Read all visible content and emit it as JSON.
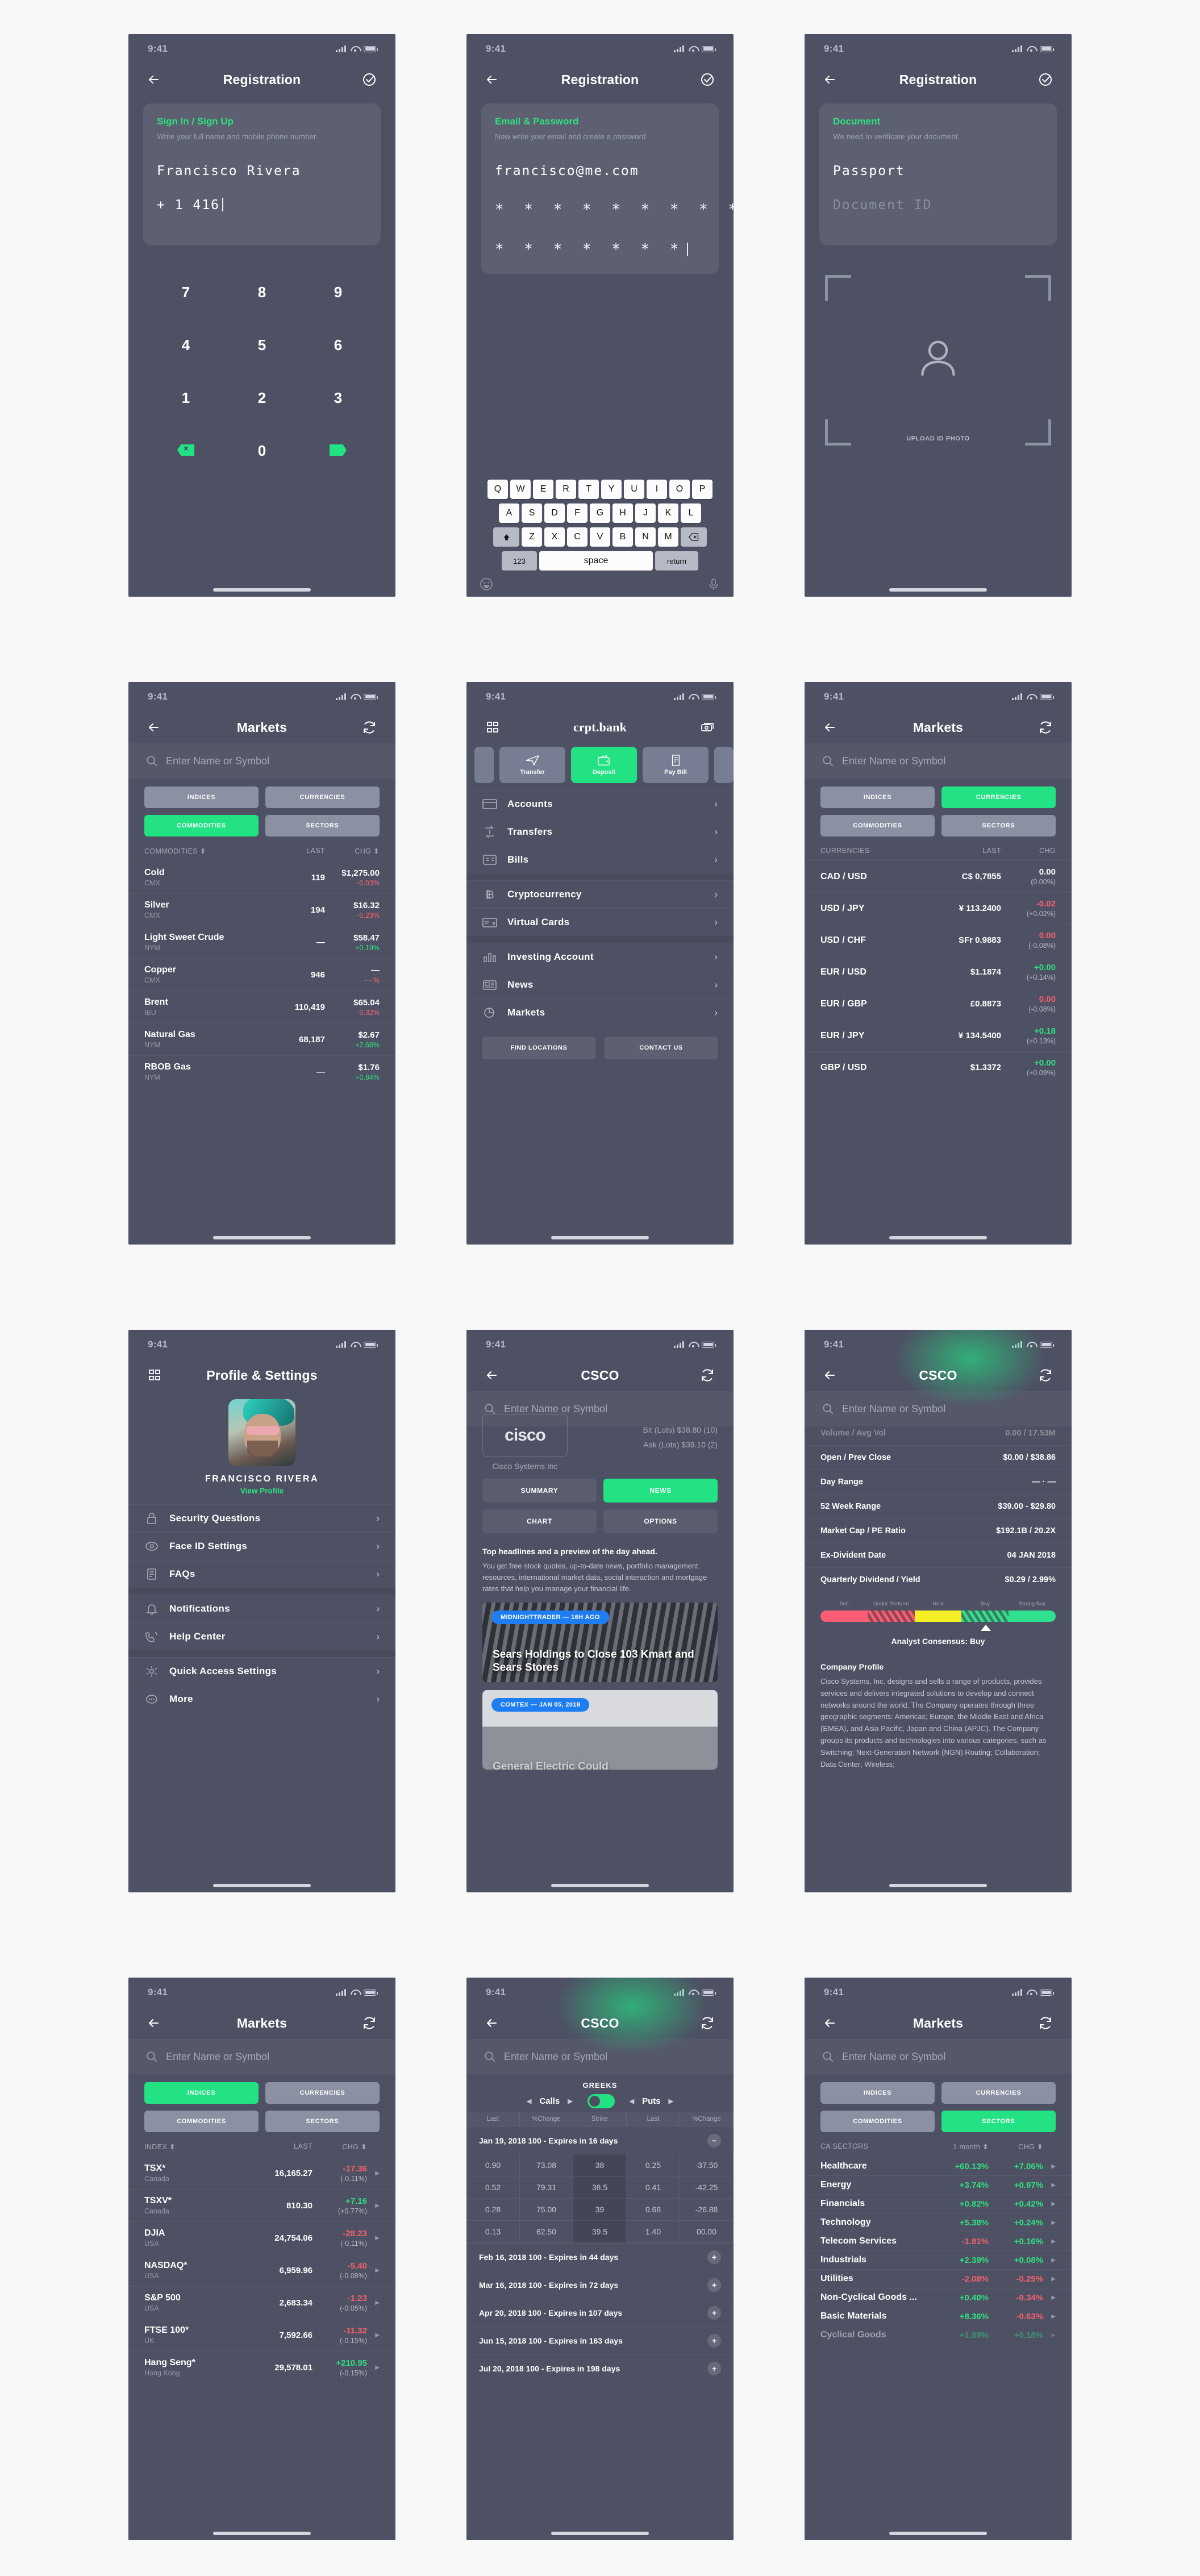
{
  "status": {
    "time": "9:41"
  },
  "screens": {
    "reg_phone": {
      "title": "Registration",
      "card": {
        "label": "Sign In / Sign Up",
        "hint": "Write your full name and mobile phone number",
        "name": "Francisco Rivera",
        "phone": "+ 1 416"
      },
      "keys": [
        "7",
        "8",
        "9",
        "4",
        "5",
        "6",
        "1",
        "2",
        "3"
      ],
      "zero": "0"
    },
    "reg_email": {
      "title": "Registration",
      "card": {
        "label": "Email & Password",
        "hint": "Now write your email and create a password",
        "email": "francisco@me.com",
        "password": "* * * * * * * * *",
        "password_confirm": "* * * * * * *"
      },
      "keyboard": {
        "row1": [
          "Q",
          "W",
          "E",
          "R",
          "T",
          "Y",
          "U",
          "I",
          "O",
          "P"
        ],
        "row2": [
          "A",
          "S",
          "D",
          "F",
          "G",
          "H",
          "J",
          "K",
          "L"
        ],
        "row3": [
          "Z",
          "X",
          "C",
          "V",
          "B",
          "N",
          "M"
        ],
        "numbers_key": "123",
        "space_key": "space",
        "return_key": "return"
      }
    },
    "reg_doc": {
      "title": "Registration",
      "card": {
        "label": "Document",
        "hint": "We need to verificate your document",
        "type": "Passport",
        "id_placeholder": "Document  ID"
      },
      "upload_label": "UPLOAD ID PHOTO"
    },
    "markets_commodities": {
      "title": "Markets",
      "search_placeholder": "Enter Name or Symbol",
      "segments": [
        "INDICES",
        "CURRENCIES",
        "COMMODITIES",
        "SECTORS"
      ],
      "active_segment": "COMMODITIES",
      "columns": [
        "COMMODITIES",
        "LAST",
        "CHG"
      ],
      "rows": [
        {
          "name": "Cold",
          "ex": "CMX",
          "last": "119",
          "price": "$1,275.00",
          "chg": "-0.03%",
          "dir": "down"
        },
        {
          "name": "Silver",
          "ex": "CMX",
          "last": "194",
          "price": "$16.32",
          "chg": "-0.23%",
          "dir": "down"
        },
        {
          "name": "Light Sweet Crude",
          "ex": "NYM",
          "last": "—",
          "price": "$58.47",
          "chg": "+0.19%",
          "dir": "up"
        },
        {
          "name": "Copper",
          "ex": "CMX",
          "last": "946",
          "price": "—",
          "chg": "- - %",
          "dir": "down"
        },
        {
          "name": "Brent",
          "ex": "IEU",
          "last": "110,419",
          "price": "$65.04",
          "chg": "-0.32%",
          "dir": "down"
        },
        {
          "name": "Natural Gas",
          "ex": "NYM",
          "last": "68,187",
          "price": "$2.67",
          "chg": "+2.66%",
          "dir": "up"
        },
        {
          "name": "RBOB Gas",
          "ex": "NYM",
          "last": "—",
          "price": "$1.76",
          "chg": "+0.84%",
          "dir": "up"
        }
      ]
    },
    "bank": {
      "title": "crpt.bank",
      "quick_actions": [
        {
          "label": "Transfer",
          "icon": "send-icon",
          "active": false
        },
        {
          "label": "Deposit",
          "icon": "wallet-icon",
          "active": true
        },
        {
          "label": "Pay Bill",
          "icon": "invoice-icon",
          "active": false
        }
      ],
      "menu_group_1": [
        {
          "label": "Accounts",
          "icon": "card-icon"
        },
        {
          "label": "Transfers",
          "icon": "exchange-icon"
        },
        {
          "label": "Bills",
          "icon": "bill-icon"
        }
      ],
      "menu_group_2": [
        {
          "label": "Cryptocurrency",
          "icon": "bitcoin-icon"
        },
        {
          "label": "Virtual Cards",
          "icon": "virtual-card-icon"
        }
      ],
      "menu_group_3": [
        {
          "label": "Investing Account",
          "icon": "bar-chart-icon"
        },
        {
          "label": "News",
          "icon": "news-icon"
        },
        {
          "label": "Markets",
          "icon": "pie-chart-icon"
        }
      ],
      "footer": [
        "FIND LOCATIONS",
        "CONTACT US"
      ]
    },
    "markets_currencies": {
      "title": "Markets",
      "search_placeholder": "Enter Name or Symbol",
      "segments": [
        "INDICES",
        "CURRENCIES",
        "COMMODITIES",
        "SECTORS"
      ],
      "active_segment": "CURRENCIES",
      "columns": [
        "CURRENCIES",
        "LAST",
        "CHG"
      ],
      "rows": [
        {
          "name": "CAD / USD",
          "last": "C$ 0,7855",
          "chg": "0.00",
          "pct": "(0.00%)",
          "dir": "white"
        },
        {
          "name": "USD / JPY",
          "last": "¥ 113.2400",
          "chg": "-0.02",
          "pct": "(+0.02%)",
          "dir": "down"
        },
        {
          "name": "USD / CHF",
          "last": "SFr 0.9883",
          "chg": "0.00",
          "pct": "(-0.08%)",
          "dir": "down"
        },
        {
          "name": "EUR / USD",
          "last": "$1.1874",
          "chg": "+0.00",
          "pct": "(+0.14%)",
          "dir": "up"
        },
        {
          "name": "EUR / GBP",
          "last": "£0.8873",
          "chg": "0.00",
          "pct": "(-0.08%)",
          "dir": "down"
        },
        {
          "name": "EUR / JPY",
          "last": "¥ 134.5400",
          "chg": "+0.18",
          "pct": "(+0.13%)",
          "dir": "up"
        },
        {
          "name": "GBP / USD",
          "last": "$1.3372",
          "chg": "+0.00",
          "pct": "(+0.09%)",
          "dir": "up"
        }
      ]
    },
    "profile": {
      "title": "Profile & Settings",
      "user_name": "FRANCISCO RIVERA",
      "view_profile": "View Profile",
      "group_1": [
        {
          "label": "Security Questions",
          "icon": "lock-icon"
        },
        {
          "label": "Face ID Settings",
          "icon": "face-id-icon"
        },
        {
          "label": "FAQs",
          "icon": "document-icon"
        }
      ],
      "group_2": [
        {
          "label": "Notifications",
          "icon": "bell-icon"
        },
        {
          "label": "Help Center",
          "icon": "phone-support-icon"
        }
      ],
      "group_3": [
        {
          "label": "Quick Access Settings",
          "icon": "gear-icon"
        },
        {
          "label": "More",
          "icon": "ellipsis-icon"
        }
      ]
    },
    "csco_news": {
      "title": "CSCO",
      "search_placeholder": "Enter Name or Symbol",
      "logo_text": "cisco",
      "company": "Cisco Systems Inc",
      "bid": "Bit (Lots) $38.80 (10)",
      "ask": "Ask (Lots) $39.10 (2)",
      "tabs": [
        "SUMMARY",
        "NEWS",
        "CHART",
        "OPTIONS"
      ],
      "active_tab": "NEWS",
      "news_heading": "Top headlines and a preview of the day ahead.",
      "news_body": "You get free stock quotes, up-to-date news, portfolio management resources, international market data, social interaction and mortgage rates that help you manage your financial life.",
      "cards": [
        {
          "badge": "MIDNIGHTTRADER — 16H AGO",
          "title": "Sears Holdings to Close 103 Kmart and Sears Stores"
        },
        {
          "badge": "COMTEX — JAN 05, 2018",
          "title": "General Electric Could"
        }
      ]
    },
    "csco_summary": {
      "title": "CSCO",
      "search_placeholder": "Enter Name or Symbol",
      "rows": [
        {
          "k": "Volume / Avg Vol",
          "v": "0.00 / 17.53M",
          "faded": true
        },
        {
          "k": "Open / Prev Close",
          "v": "$0.00  / $38.86",
          "faded": false
        },
        {
          "k": "Day Range",
          "v": "— · —",
          "faded": false
        },
        {
          "k": "52 Week Range",
          "v": "$39.00 - $29.80",
          "faded": false
        },
        {
          "k": "Market Cap / PE Ratio",
          "v": "$192.1B / 20.2X",
          "faded": false
        },
        {
          "k": "Ex-Divident Date",
          "v": "04 JAN 2018",
          "faded": false
        },
        {
          "k": "Quarterly Dividend / Yield",
          "v": "$0.29 / 2.99%",
          "faded": false
        }
      ],
      "consensus_labels": [
        "Sell",
        "Under Perform",
        "Hold",
        "Buy",
        "Strong Buy"
      ],
      "consensus_text": "Analyst Consensus: Buy",
      "profile_heading": "Company Profile",
      "profile_body": "Cisco Systems, Inc. designs and sells a range of products, provides services and delivers integrated solutions to develop and connect networks around the world. The Company operates through three geographic segments: Americas; Europe, the Middle East and Africa (EMEA), and Asia Pacific, Japan and China (APJC). The Company groups its products and technologies into various categories, such as Switching; Next-Generation Network (NGN) Routing; Collaboration; Data Center; Wireless;"
    },
    "markets_indices": {
      "title": "Markets",
      "search_placeholder": "Enter Name or Symbol",
      "segments": [
        "INDICES",
        "CURRENCIES",
        "COMMODITIES",
        "SECTORS"
      ],
      "active_segment": "INDICES",
      "columns": [
        "INDEX",
        "LAST",
        "CHG"
      ],
      "rows": [
        {
          "name": "TSX*",
          "ex": "Canada",
          "last": "16,165.27",
          "chg": "-17.36",
          "pct": "(-0.11%)",
          "dir": "down"
        },
        {
          "name": "TSXV*",
          "ex": "Canada",
          "last": "810.30",
          "chg": "+7.16",
          "pct": "(+0.77%)",
          "dir": "up"
        },
        {
          "name": "DJIA",
          "ex": "USA",
          "last": "24,754.06",
          "chg": "-28.23",
          "pct": "(-0.11%)",
          "dir": "down"
        },
        {
          "name": "NASDAQ*",
          "ex": "USA",
          "last": "6,959.96",
          "chg": "-5.40",
          "pct": "(-0.08%)",
          "dir": "down"
        },
        {
          "name": "S&P 500",
          "ex": "USA",
          "last": "2,683.34",
          "chg": "-1.23",
          "pct": "(-0.05%)",
          "dir": "down"
        },
        {
          "name": "FTSE 100*",
          "ex": "UK",
          "last": "7,592.66",
          "chg": "-11.32",
          "pct": "(-0.15%)",
          "dir": "down"
        },
        {
          "name": "Hang Seng*",
          "ex": "Hong Kong",
          "last": "29,578.01",
          "chg": "+210.95",
          "pct": "(-0.15%)",
          "dir": "up"
        }
      ]
    },
    "csco_options": {
      "title": "CSCO",
      "search_placeholder": "Enter Name or Symbol",
      "greeks_label": "GREEKS",
      "calls_label": "Calls",
      "puts_label": "Puts",
      "columns": [
        "Last",
        "%Change",
        "Strike",
        "Last",
        "%Change"
      ],
      "expiry_open": "Jan 19, 2018 100 - Expires in 16 days",
      "chain": [
        [
          "0.90",
          "73.08",
          "38",
          "0.25",
          "-37.50"
        ],
        [
          "0.52",
          "79.31",
          "38.5",
          "0.41",
          "-42.25"
        ],
        [
          "0.28",
          "75.00",
          "39",
          "0.68",
          "-26.88"
        ],
        [
          "0.13",
          "62.50",
          "39.5",
          "1.40",
          "00.00"
        ]
      ],
      "expiries": [
        "Feb 16, 2018 100 - Expires in 44 days",
        "Mar 16, 2018 100 - Expires in 72 days",
        "Apr 20, 2018 100 - Expires in 107 days",
        "Jun 15, 2018 100 - Expires in 163 days",
        "Jul 20, 2018 100 - Expires in 198 days"
      ]
    },
    "markets_sectors": {
      "title": "Markets",
      "search_placeholder": "Enter Name or Symbol",
      "segments": [
        "INDICES",
        "CURRENCIES",
        "COMMODITIES",
        "SECTORS"
      ],
      "active_segment": "SECTORS",
      "columns": [
        "CA SECTORS",
        "1 month",
        "CHG"
      ],
      "rows": [
        {
          "name": "Healthcare",
          "month": "+60.13%",
          "mdir": "up",
          "chg": "+7.06%",
          "dir": "up"
        },
        {
          "name": "Energy",
          "month": "+3.74%",
          "mdir": "up",
          "chg": "+0.97%",
          "dir": "up"
        },
        {
          "name": "Financials",
          "month": "+0.82%",
          "mdir": "up",
          "chg": "+0.42%",
          "dir": "up"
        },
        {
          "name": "Technology",
          "month": "+5.38%",
          "mdir": "up",
          "chg": "+0.24%",
          "dir": "up"
        },
        {
          "name": "Telecom Services",
          "month": "-1.81%",
          "mdir": "down",
          "chg": "+0.16%",
          "dir": "up"
        },
        {
          "name": "Industrials",
          "month": "+2.39%",
          "mdir": "up",
          "chg": "+0.08%",
          "dir": "up"
        },
        {
          "name": "Utilities",
          "month": "-2.08%",
          "mdir": "down",
          "chg": "-0.25%",
          "dir": "down"
        },
        {
          "name": "Non-Cyclical Goods ...",
          "month": "+0.40%",
          "mdir": "up",
          "chg": "-0.34%",
          "dir": "down"
        },
        {
          "name": "Basic Materials",
          "month": "+8.36%",
          "mdir": "up",
          "chg": "-0.63%",
          "dir": "down"
        },
        {
          "name": "Cyclical Goods",
          "month": "+1.89%",
          "mdir": "up",
          "chg": "+0.18%",
          "dir": "up"
        }
      ]
    }
  },
  "colors": {
    "accent": "#22e283",
    "down": "#f2606b",
    "bg": "#4d5163",
    "badge": "#1f7df2"
  }
}
